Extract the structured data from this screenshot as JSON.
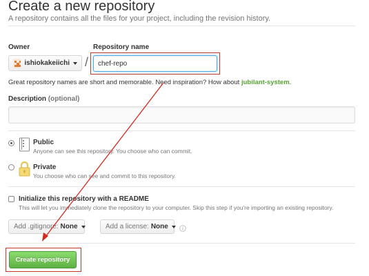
{
  "header": {
    "title": "Create a new repository",
    "subtitle": "A repository contains all the files for your project, including the revision history."
  },
  "owner": {
    "label": "Owner",
    "value": "ishiokakeiichi"
  },
  "separator": "/",
  "repo_name": {
    "label": "Repository name",
    "value": "chef-repo"
  },
  "hint": {
    "text": "Great repository names are short and memorable. Need inspiration? How about ",
    "suggestion": "jubilant-system",
    "end": "."
  },
  "description": {
    "label": "Description",
    "optional": "(optional)",
    "value": ""
  },
  "visibility": {
    "public": {
      "title": "Public",
      "desc": "Anyone can see this repository. You choose who can commit.",
      "selected": true
    },
    "private": {
      "title": "Private",
      "desc": "You choose who can see and commit to this repository.",
      "selected": false
    }
  },
  "readme": {
    "title": "Initialize this repository with a README",
    "desc": "This will let you immediately clone the repository to your computer. Skip this step if you're importing an existing repository.",
    "checked": false
  },
  "gitignore": {
    "label": "Add .gitignore:",
    "value": "None"
  },
  "license": {
    "label": "Add a license:",
    "value": "None"
  },
  "submit_label": "Create repository",
  "colors": {
    "accent_green": "#60b044",
    "suggestion_green": "#55a532",
    "annotation_red": "#c0392b"
  }
}
